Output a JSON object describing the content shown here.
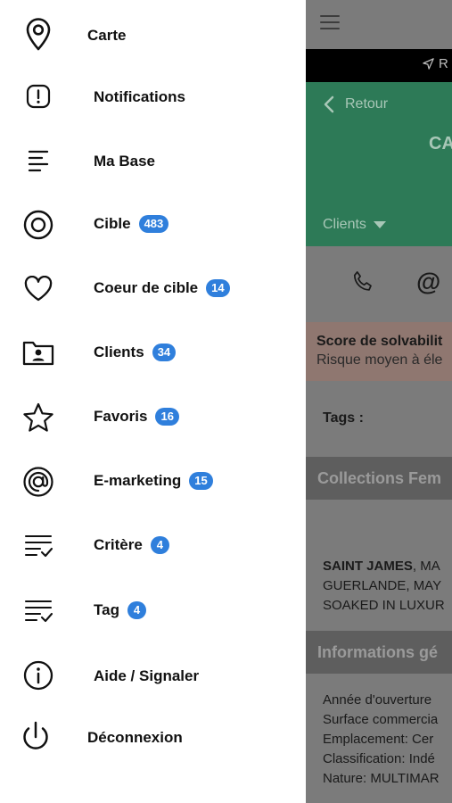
{
  "menu": {
    "items": [
      {
        "id": "carte",
        "label": "Carte",
        "icon": "map-pin-icon",
        "badge": null
      },
      {
        "id": "notifications",
        "label": "Notifications",
        "icon": "alert-icon",
        "badge": null
      },
      {
        "id": "ma-base",
        "label": "Ma Base",
        "icon": "lines-icon",
        "badge": null
      },
      {
        "id": "cible",
        "label": "Cible",
        "icon": "target-icon",
        "badge": "483"
      },
      {
        "id": "coeur-de-cible",
        "label": "Coeur de cible",
        "icon": "heart-icon",
        "badge": "14"
      },
      {
        "id": "clients",
        "label": "Clients",
        "icon": "contact-folder-icon",
        "badge": "34"
      },
      {
        "id": "favoris",
        "label": "Favoris",
        "icon": "star-icon",
        "badge": "16"
      },
      {
        "id": "e-marketing",
        "label": "E-marketing",
        "icon": "at-sign-icon",
        "badge": "15"
      },
      {
        "id": "critere",
        "label": "Critère",
        "icon": "checklist-icon",
        "badge": "4"
      },
      {
        "id": "tag",
        "label": "Tag",
        "icon": "checklist-icon",
        "badge": "4"
      },
      {
        "id": "aide",
        "label": "Aide / Signaler",
        "icon": "info-icon",
        "badge": null
      },
      {
        "id": "deconnexion",
        "label": "Déconnexion",
        "icon": "power-icon",
        "badge": null
      }
    ]
  },
  "background": {
    "route_label": "R",
    "back_label": "Retour",
    "title": "CA",
    "dropdown_label": "Clients",
    "score_title": "Score de solvabilit",
    "score_sub": "Risque moyen à éle",
    "tags_label": "Tags :",
    "section1_label": "Collections Fem",
    "collections_lines": [
      "SAINT JAMES, MA",
      "GUERLANDE, MAY",
      "SOAKED IN LUXUR"
    ],
    "collections_bold": "SAINT JAMES",
    "section2_label": "Informations gé",
    "info_lines": [
      "Année d'ouverture",
      "Surface commercia",
      "Emplacement: Cer",
      "Classification: Indé",
      "Nature: MULTIMAR"
    ]
  },
  "colors": {
    "badge": "#2f7fdc",
    "accent_green": "#2d7a57"
  }
}
